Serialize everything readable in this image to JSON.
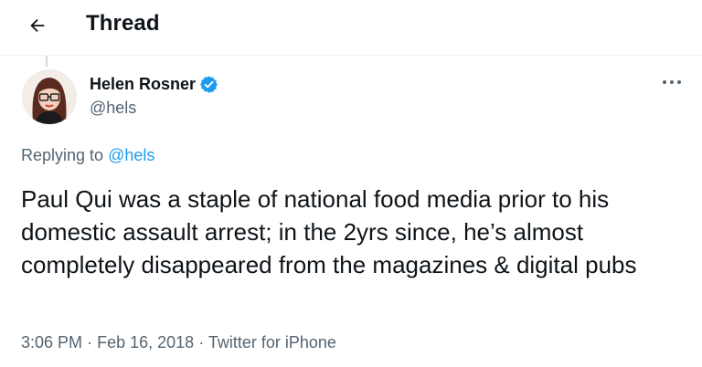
{
  "header": {
    "title": "Thread",
    "back_icon": "arrow-left-icon"
  },
  "tweet": {
    "author_name": "Helen Rosner",
    "author_handle": "@hels",
    "verified_icon": "verified-badge-icon",
    "more_icon": "more-dots-icon",
    "replying_prefix": "Replying to",
    "replying_to": "@hels",
    "text": "Paul Qui was a staple of national food media prior to his domestic assault arrest; in the 2yrs since, he’s almost completely disappeared from the magazines & digital pubs",
    "time": "3:06 PM",
    "separator": "·",
    "date": "Feb 16, 2018",
    "source": "Twitter for iPhone"
  },
  "colors": {
    "accent": "#1d9bf0",
    "text": "#0f1419",
    "secondary": "#536471",
    "divider": "#eff3f4"
  }
}
